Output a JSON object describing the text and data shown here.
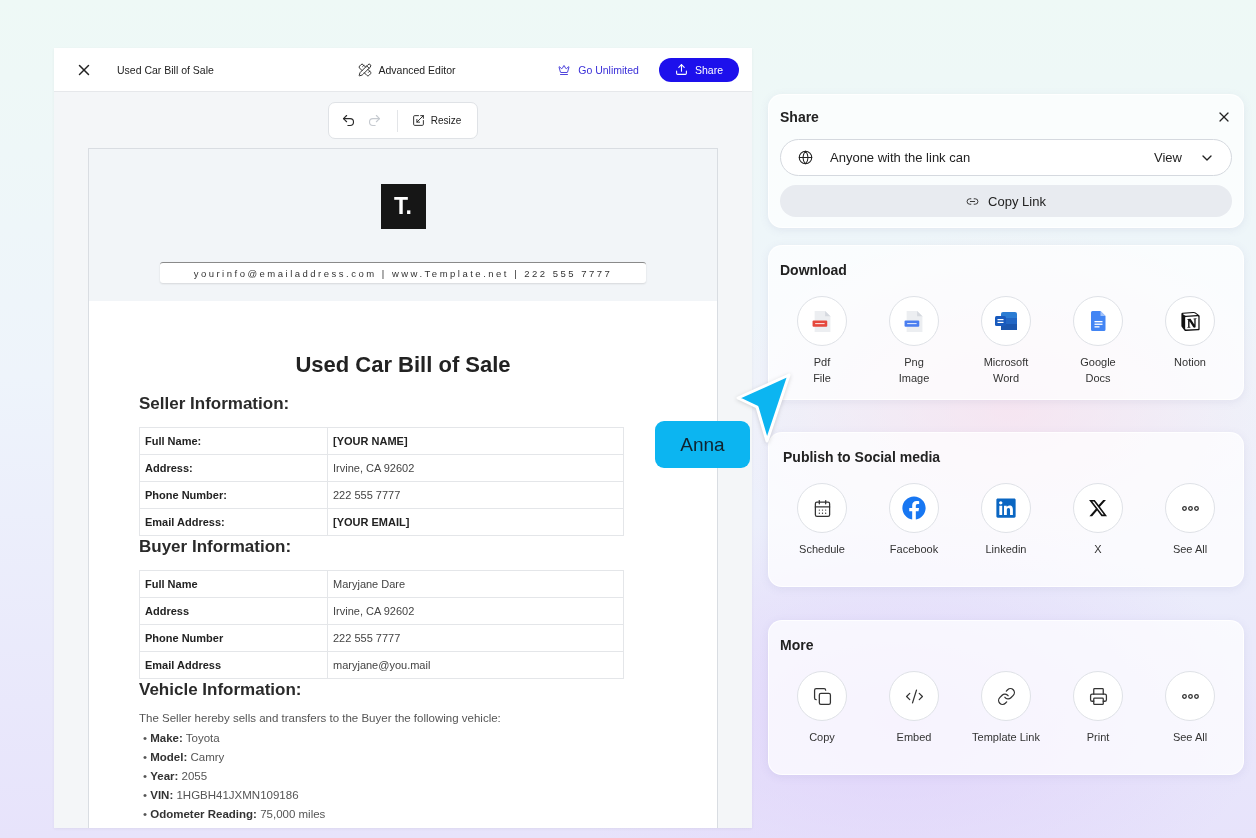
{
  "editor": {
    "title": "Used Car Bill of Sale",
    "mode": "Advanced Editor",
    "upgrade": "Go Unlimited",
    "share": "Share"
  },
  "toolbar": {
    "history": [
      {
        "kind": "undo",
        "disabled": false
      },
      {
        "kind": "redo",
        "disabled": true
      }
    ],
    "resize": "Resize"
  },
  "document": {
    "logo": "T.",
    "contact": "yourinfo@emailaddress.com | www.Template.net | 222 555 7777",
    "title": "Used Car Bill of Sale",
    "sections": [
      {
        "kind": "table",
        "heading": "Seller Information:",
        "rows": [
          {
            "label": "Full Name:",
            "value": "[YOUR NAME]",
            "emphasized": true
          },
          {
            "label": "Address:",
            "value": "Irvine, CA 92602",
            "emphasized": false
          },
          {
            "label": "Phone Number:",
            "value": "222 555 7777",
            "emphasized": false
          },
          {
            "label": "Email Address:",
            "value": "[YOUR EMAIL]",
            "emphasized": true
          }
        ]
      },
      {
        "kind": "table",
        "heading": "Buyer Information:",
        "rows": [
          {
            "label": "Full Name",
            "value": "Maryjane Dare",
            "emphasized": false
          },
          {
            "label": "Address",
            "value": "Irvine, CA 92602",
            "emphasized": false
          },
          {
            "label": "Phone Number",
            "value": "222 555 7777",
            "emphasized": false
          },
          {
            "label": "Email Address",
            "value": "maryjane@you.mail",
            "emphasized": false
          }
        ]
      },
      {
        "kind": "list",
        "heading": "Vehicle Information:",
        "intro": "The Seller hereby sells and transfers to the Buyer the following vehicle:",
        "items": [
          "• **Make:** Toyota",
          "• **Model:** Camry",
          "• **Year:** 2055",
          "• **VIN:** 1HGBH41JXMN109186",
          "• **Odometer Reading:** 75,000 miles"
        ]
      }
    ]
  },
  "share": {
    "title": "Share",
    "access": "Anyone with the link can",
    "permission": "View",
    "copy_link": "Copy Link"
  },
  "panels": [
    {
      "kind": "download",
      "title": "Download",
      "options": [
        {
          "kind": "pdf",
          "label": "Pdf File"
        },
        {
          "kind": "png",
          "label": "Png Image"
        },
        {
          "kind": "word",
          "label": "Microsoft Word"
        },
        {
          "kind": "docs",
          "label": "Google Docs"
        },
        {
          "kind": "notion",
          "label": "Notion"
        }
      ]
    },
    {
      "kind": "social",
      "title": "Publish to Social media",
      "options": [
        {
          "kind": "schedule",
          "label": "Schedule"
        },
        {
          "kind": "facebook",
          "label": "Facebook"
        },
        {
          "kind": "linkedin",
          "label": "Linkedin"
        },
        {
          "kind": "x",
          "label": "X"
        },
        {
          "kind": "more",
          "label": "See All"
        }
      ]
    },
    {
      "kind": "more",
      "title": "More",
      "options": [
        {
          "kind": "copy",
          "label": "Copy"
        },
        {
          "kind": "embed",
          "label": "Embed"
        },
        {
          "kind": "link",
          "label": "Template Link"
        },
        {
          "kind": "print",
          "label": "Print"
        },
        {
          "kind": "more",
          "label": "See All"
        }
      ]
    }
  ],
  "cursor": {
    "name": "Anna"
  }
}
